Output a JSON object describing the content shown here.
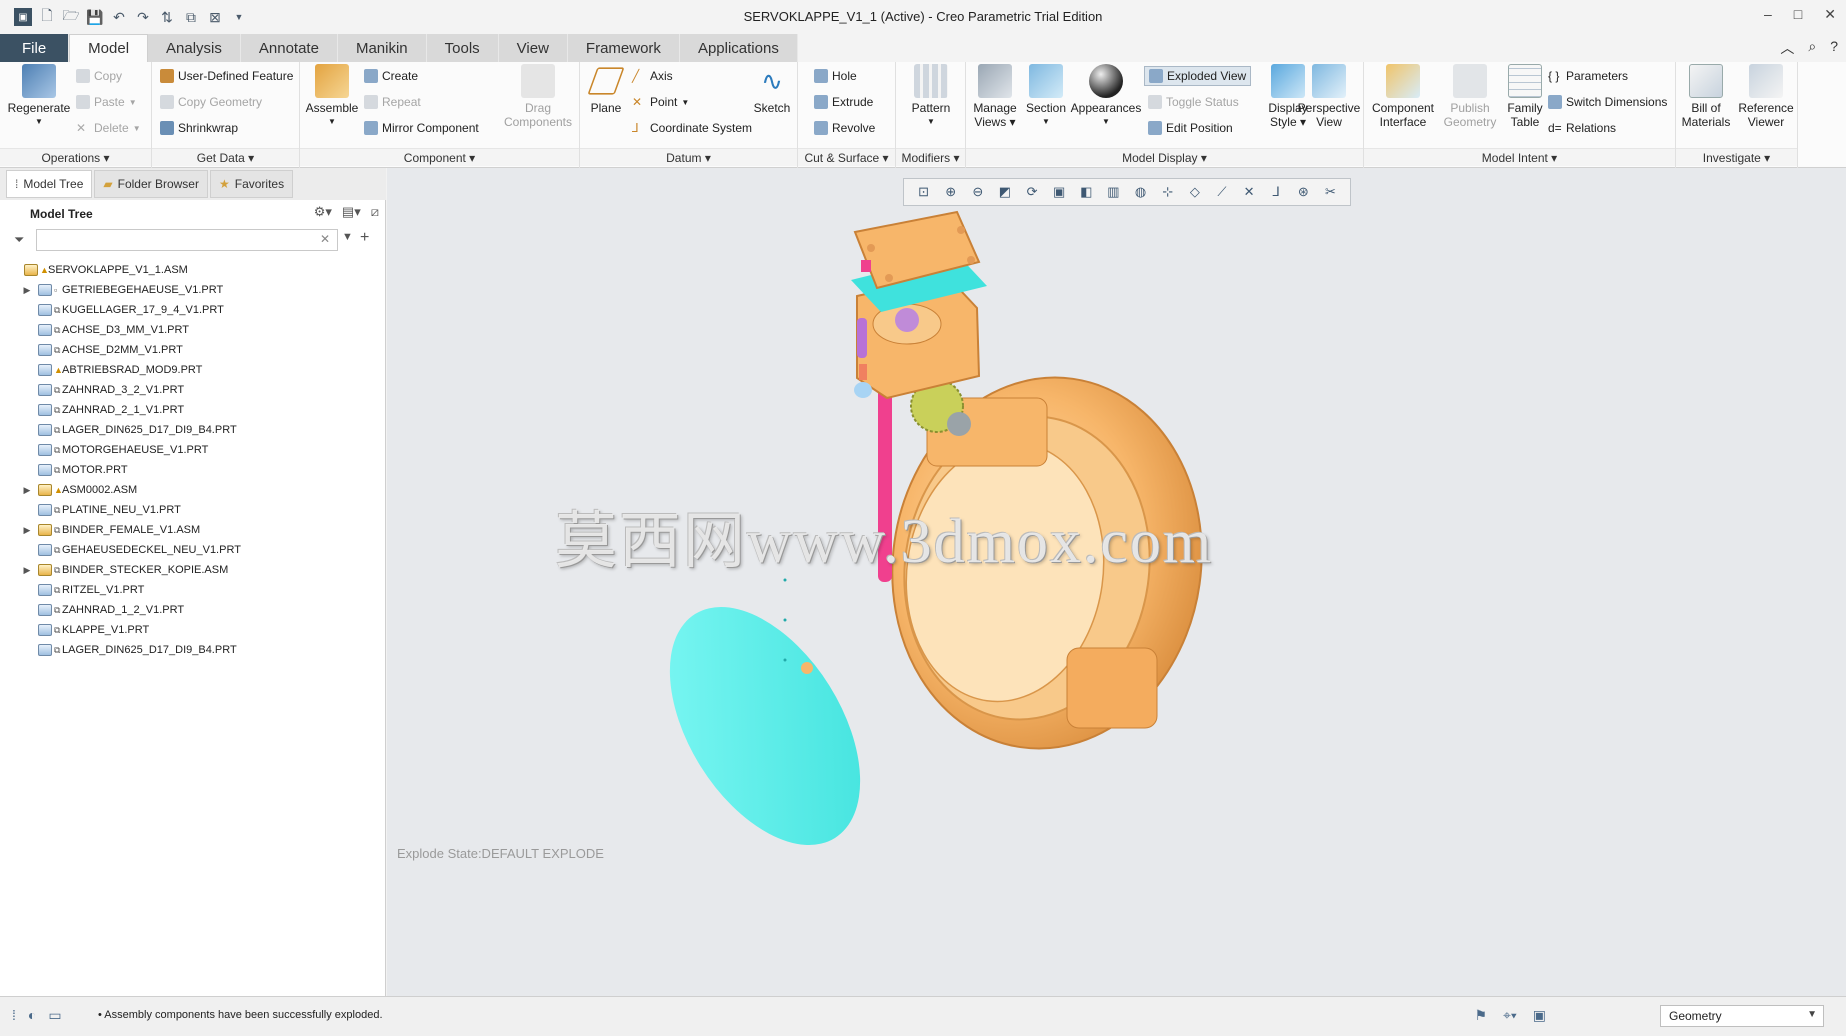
{
  "window": {
    "title": "SERVOKLAPPE_V1_1 (Active) - Creo Parametric Trial Edition",
    "controls": [
      "–",
      "□",
      "✕"
    ]
  },
  "tabs": [
    "File",
    "Model",
    "Analysis",
    "Annotate",
    "Manikin",
    "Tools",
    "View",
    "Framework",
    "Applications"
  ],
  "ribbon": {
    "operations": {
      "regenerate": "Regenerate",
      "copy": "Copy",
      "paste": "Paste",
      "delete": "Delete",
      "label": "Operations"
    },
    "get_data": {
      "udf": "User-Defined Feature",
      "copy_geometry": "Copy Geometry",
      "shrinkwrap": "Shrinkwrap",
      "label": "Get Data"
    },
    "component": {
      "assemble": "Assemble",
      "create": "Create",
      "repeat": "Repeat",
      "mirror": "Mirror Component",
      "drag_1": "Drag",
      "drag_2": "Components",
      "label": "Component"
    },
    "datum": {
      "plane": "Plane",
      "axis": "Axis",
      "point": "Point",
      "csys": "Coordinate System",
      "sketch": "Sketch",
      "label": "Datum"
    },
    "cut_surface": {
      "hole": "Hole",
      "extrude": "Extrude",
      "revolve": "Revolve",
      "label": "Cut & Surface"
    },
    "modifiers": {
      "pattern": "Pattern",
      "label": "Modifiers"
    },
    "model_display": {
      "manage_views_1": "Manage",
      "manage_views_2": "Views",
      "section": "Section",
      "appearances": "Appearances",
      "exploded_view": "Exploded View",
      "toggle_status": "Toggle Status",
      "edit_position": "Edit Position",
      "display_style_1": "Display",
      "display_style_2": "Style",
      "perspective_1": "Perspective",
      "perspective_2": "View",
      "label": "Model Display"
    },
    "model_intent": {
      "component_interface_1": "Component",
      "component_interface_2": "Interface",
      "publish_geometry_1": "Publish",
      "publish_geometry_2": "Geometry",
      "family_table_1": "Family",
      "family_table_2": "Table",
      "parameters": "Parameters",
      "switch_dimensions": "Switch Dimensions",
      "relations": "Relations",
      "label": "Model Intent"
    },
    "investigate": {
      "bom_1": "Bill of",
      "bom_2": "Materials",
      "ref_viewer_1": "Reference",
      "ref_viewer_2": "Viewer",
      "label": "Investigate"
    }
  },
  "left_pane": {
    "tabs": [
      "Model Tree",
      "Folder Browser",
      "Favorites"
    ],
    "header": "Model Tree",
    "search_placeholder": "",
    "tree": [
      {
        "name": "SERVOKLAPPE_V1_1.ASM",
        "type": "asm",
        "expand": "",
        "mark": "▲",
        "root": true
      },
      {
        "name": "GETRIEBEGEHAEUSE_V1.PRT",
        "type": "prt",
        "expand": "▶",
        "mark": "▫"
      },
      {
        "name": "KUGELLAGER_17_9_4_V1.PRT",
        "type": "prt",
        "expand": "",
        "mark": "⧉"
      },
      {
        "name": "ACHSE_D3_MM_V1.PRT",
        "type": "prt",
        "expand": "",
        "mark": "⧉"
      },
      {
        "name": "ACHSE_D2MM_V1.PRT",
        "type": "prt",
        "expand": "",
        "mark": "⧉"
      },
      {
        "name": "ABTRIEBSRAD_MOD9.PRT",
        "type": "prt",
        "expand": "",
        "mark": "▲"
      },
      {
        "name": "ZAHNRAD_3_2_V1.PRT",
        "type": "prt",
        "expand": "",
        "mark": "⧉"
      },
      {
        "name": "ZAHNRAD_2_1_V1.PRT",
        "type": "prt",
        "expand": "",
        "mark": "⧉"
      },
      {
        "name": "LAGER_DIN625_D17_DI9_B4.PRT",
        "type": "prt",
        "expand": "",
        "mark": "⧉"
      },
      {
        "name": "MOTORGEHAEUSE_V1.PRT",
        "type": "prt",
        "expand": "",
        "mark": "⧉"
      },
      {
        "name": "MOTOR.PRT",
        "type": "prt",
        "expand": "",
        "mark": "⧉"
      },
      {
        "name": "ASM0002.ASM",
        "type": "asm",
        "expand": "▶",
        "mark": "▲"
      },
      {
        "name": "PLATINE_NEU_V1.PRT",
        "type": "prt",
        "expand": "",
        "mark": "⧉"
      },
      {
        "name": "BINDER_FEMALE_V1.ASM",
        "type": "asm",
        "expand": "▶",
        "mark": "⧉"
      },
      {
        "name": "GEHAEUSEDECKEL_NEU_V1.PRT",
        "type": "prt",
        "expand": "",
        "mark": "⧉"
      },
      {
        "name": "BINDER_STECKER_KOPIE.ASM",
        "type": "asm",
        "expand": "▶",
        "mark": "⧉"
      },
      {
        "name": "RITZEL_V1.PRT",
        "type": "prt",
        "expand": "",
        "mark": "⧉"
      },
      {
        "name": "ZAHNRAD_1_2_V1.PRT",
        "type": "prt",
        "expand": "",
        "mark": "⧉"
      },
      {
        "name": "KLAPPE_V1.PRT",
        "type": "prt",
        "expand": "",
        "mark": "⧉"
      },
      {
        "name": "LAGER_DIN625_D17_DI9_B4.PRT",
        "type": "prt",
        "expand": "",
        "mark": "⧉"
      }
    ]
  },
  "graphics": {
    "explode_state": "Explode State:DEFAULT EXPLODE",
    "watermark": "莫西网www.3dmox.com",
    "colors": {
      "housing": "#f7b66a",
      "flap": "#5ff4ef",
      "shaft": "#f0408e",
      "background": "#e7e9ec"
    }
  },
  "statusbar": {
    "message": "• Assembly components have been successfully exploded.",
    "selection_filter": "Geometry"
  }
}
